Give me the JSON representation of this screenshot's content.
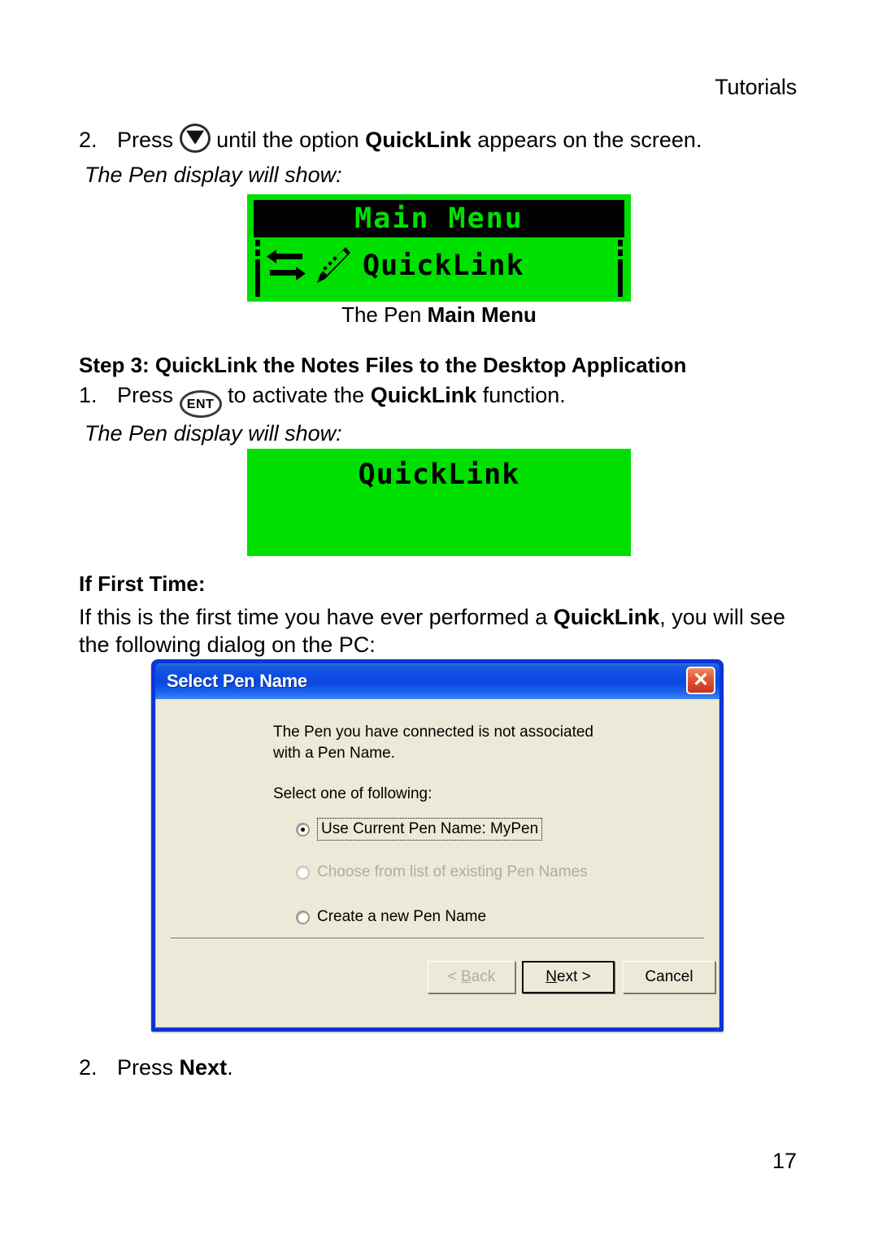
{
  "header": {
    "title": "Tutorials"
  },
  "page_number": "17",
  "step2_top": {
    "number": "2.",
    "text_before": "Press",
    "key_icon": "down-arrow-key",
    "text_middle": "until the option",
    "bold_term": "QuickLink",
    "text_after": "appears on the screen."
  },
  "pen_display_note_1": "The Pen display will show:",
  "pen_display_1": {
    "title": "Main Menu",
    "item_label": "QuickLink",
    "icons": [
      "sync-arrows-icon",
      "pen-icon"
    ]
  },
  "caption_1": {
    "prefix": "The Pen ",
    "bold": "Main Menu"
  },
  "step3_heading": {
    "bold_label": "Step 3",
    "text": ": QuickLink the Notes Files to the Desktop Application"
  },
  "step3_item1": {
    "number": "1.",
    "text_before": "Press",
    "key_icon": "ent-key",
    "key_label": "ENT",
    "text_middle": "to activate the",
    "bold_term": "QuickLink",
    "text_after": "function."
  },
  "pen_display_note_2": "The Pen display will show:",
  "pen_display_2": {
    "title": "QuickLink"
  },
  "if_first_time": {
    "heading": "If First Time:",
    "body_before": "If this is the first time you have ever performed a ",
    "body_bold": "QuickLink",
    "body_after": ", you will see the following dialog on the PC:"
  },
  "dialog": {
    "title": "Select Pen Name",
    "close_icon": "close-icon",
    "close_glyph": "✕",
    "message_line1": "The Pen you have connected is not associated",
    "message_line2": "with a Pen Name.",
    "prompt": "Select one of following:",
    "options": [
      {
        "label": "Use Current Pen Name:  MyPen",
        "checked": true,
        "disabled": false,
        "focused": true
      },
      {
        "label": "Choose from list of existing Pen Names",
        "checked": false,
        "disabled": true,
        "focused": false
      },
      {
        "label": "Create a new Pen Name",
        "checked": false,
        "disabled": false,
        "focused": false
      }
    ],
    "buttons": {
      "back": {
        "pre": "< ",
        "accel": "B",
        "post": "ack",
        "disabled": true,
        "default": false
      },
      "next": {
        "pre": "",
        "accel": "N",
        "post": "ext >",
        "disabled": false,
        "default": true
      },
      "cancel": {
        "label": "Cancel",
        "disabled": false,
        "default": false
      }
    }
  },
  "step2_bottom": {
    "number": "2.",
    "text_before": "Press",
    "bold_term": "Next",
    "text_after": "."
  },
  "colors": {
    "lcd_green": "#00e000",
    "lcd_black": "#000000",
    "dialog_blue": "#0a36d8",
    "dialog_face": "#ece9d8",
    "close_red": "#c5341c"
  }
}
